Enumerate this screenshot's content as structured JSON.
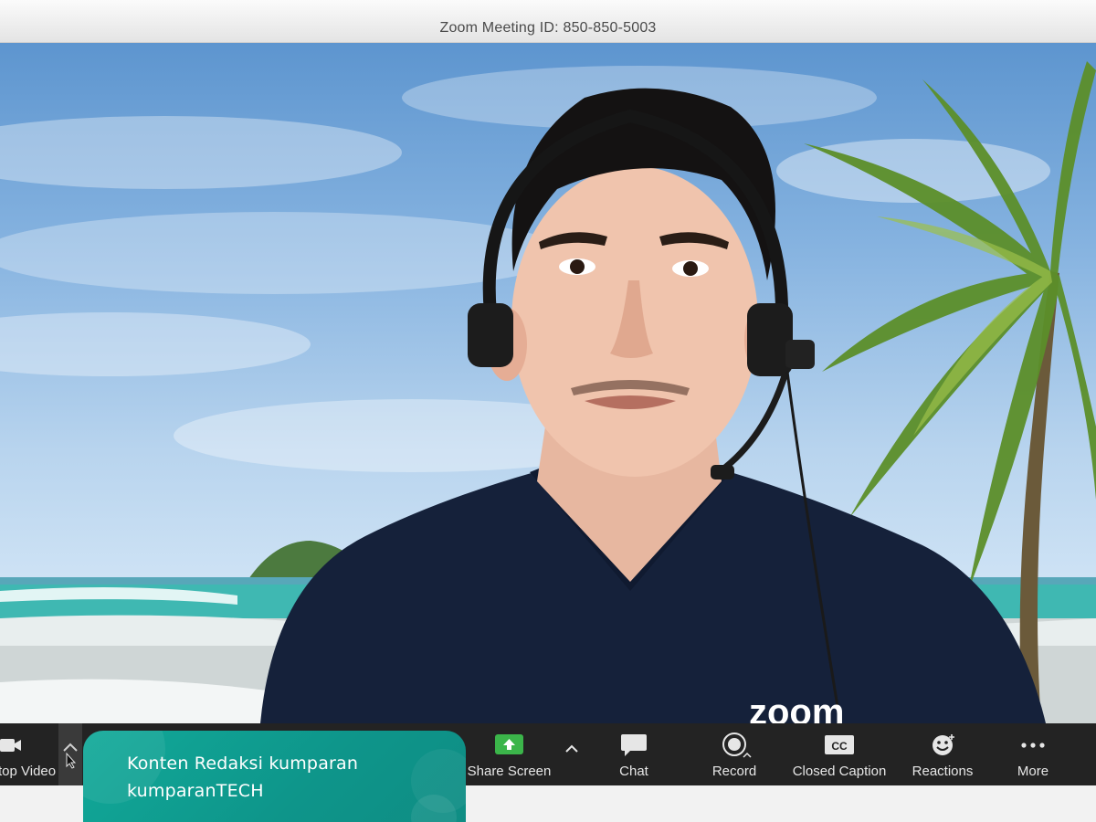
{
  "window": {
    "title": "Zoom Meeting ID: 850-850-5003"
  },
  "video": {
    "shirt_logo_text": "zoom"
  },
  "toolbar": {
    "stop_video_label": "Stop Video",
    "share_screen_label": "Share Screen",
    "chat_label": "Chat",
    "record_label": "Record",
    "closed_caption_label": "Closed Caption",
    "closed_caption_icon_text": "CC",
    "reactions_label": "Reactions",
    "more_label": "More"
  },
  "overlay": {
    "line1": "Konten Redaksi kumparan",
    "line2": "kumparanTECH"
  },
  "colors": {
    "toolbar_bg": "#232323",
    "share_green": "#3bb54a",
    "overlay_teal": "#11a999"
  }
}
